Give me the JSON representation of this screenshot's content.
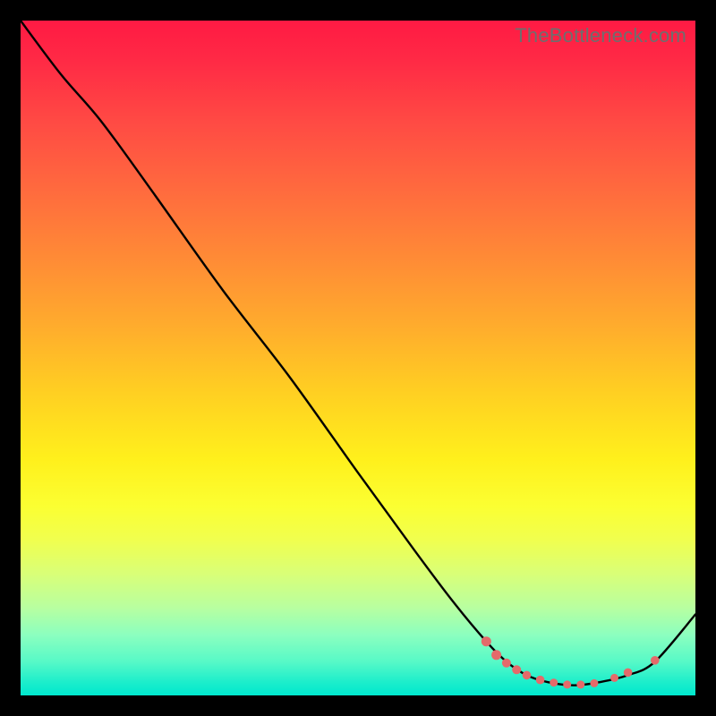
{
  "watermark": "TheBottleneck.com",
  "chart_data": {
    "type": "line",
    "title": "",
    "xlabel": "",
    "ylabel": "",
    "xlim": [
      0,
      100
    ],
    "ylim": [
      0,
      100
    ],
    "grid": false,
    "legend": false,
    "series": [
      {
        "name": "curve",
        "x": [
          0,
          6,
          12,
          20,
          30,
          40,
          50,
          58,
          64,
          69,
          72,
          75,
          78,
          82,
          86,
          90,
          94,
          100
        ],
        "y": [
          100,
          92,
          85,
          74,
          60,
          47,
          33,
          22,
          14,
          8,
          5,
          3,
          2,
          1.5,
          2,
          3,
          5,
          12
        ]
      }
    ],
    "markers": {
      "name": "dots",
      "x": [
        69.0,
        70.5,
        72.0,
        73.5,
        75.0,
        77.0,
        79.0,
        81.0,
        83.0,
        85.0,
        88.0,
        90.0,
        94.0
      ],
      "y": [
        8.0,
        6.0,
        4.8,
        3.8,
        3.0,
        2.3,
        1.9,
        1.6,
        1.6,
        1.8,
        2.6,
        3.4,
        5.2
      ],
      "r": [
        5.5,
        5.5,
        5.0,
        5.0,
        4.8,
        4.8,
        4.5,
        4.5,
        4.5,
        4.5,
        4.5,
        4.8,
        4.8
      ]
    },
    "colors": {
      "curve": "#000000",
      "dots": "#e46a6a"
    }
  }
}
